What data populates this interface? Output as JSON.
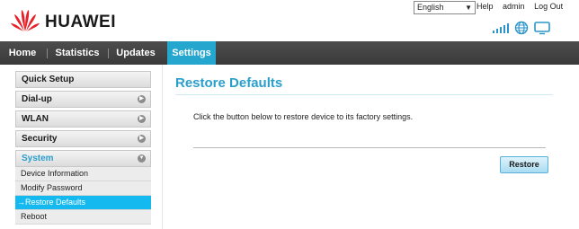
{
  "brand": {
    "name": "HUAWEI"
  },
  "top_bar": {
    "language": "English",
    "links": [
      "Help",
      "admin",
      "Log Out"
    ]
  },
  "status_icons": [
    "signal-strength-icon",
    "globe-icon",
    "monitor-icon"
  ],
  "nav": {
    "items": [
      "Home",
      "Statistics",
      "Updates",
      "Settings"
    ],
    "active": "Settings"
  },
  "sidebar": {
    "items": [
      "Quick Setup",
      "Dial-up",
      "WLAN",
      "Security",
      "System"
    ],
    "system_sub": [
      "Device Information",
      "Modify Password",
      "→Restore Defaults",
      "Reboot"
    ]
  },
  "content": {
    "title": "Restore Defaults",
    "description": "Click the button below to restore device to its factory settings.",
    "button": "Restore"
  },
  "colors": {
    "accent": "#25a6cf",
    "nav_bg": "#444444",
    "active_sub": "#14b9ef",
    "brand_red": "#e8202a"
  }
}
